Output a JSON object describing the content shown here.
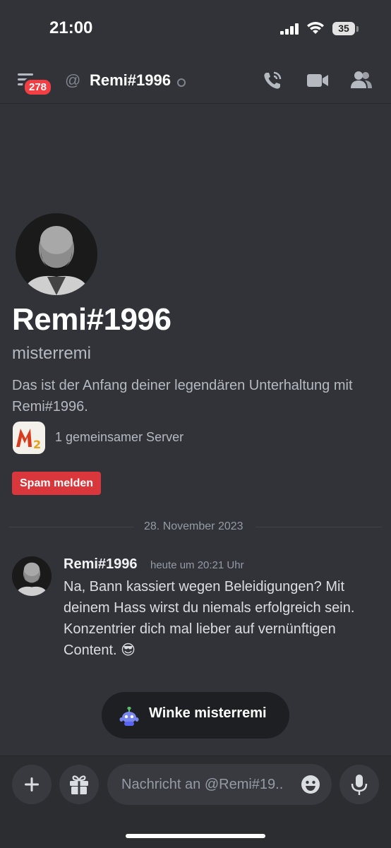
{
  "status_bar": {
    "time": "21:00",
    "battery": "35"
  },
  "header": {
    "notification_count": "278",
    "at_symbol": "@",
    "title": "Remi#1996"
  },
  "profile": {
    "display_name": "Remi#1996",
    "username": "misterremi",
    "intro": "Das ist der Anfang deiner legendären Unterhaltung mit Remi#1996.",
    "mutual_servers": "1 gemeinsamer Server",
    "spam_button": "Spam melden"
  },
  "date_divider": "28. November 2023",
  "message": {
    "author": "Remi#1996",
    "timestamp": "heute um 20:21 Uhr",
    "text": "Na, Bann kassiert wegen Beleidigungen? Mit deinem Hass wirst du niemals erfolgreich sein. Konzentrier dich mal lieber auf vernünftigen Content.",
    "emoji": "😎"
  },
  "wave_button": {
    "label": "Winke misterremi"
  },
  "composer": {
    "placeholder": "Nachricht an @Remi#19.."
  },
  "colors": {
    "background": "#313338",
    "danger": "#da373c",
    "badge": "#f23f43",
    "dark_surface": "#1e1f22"
  },
  "icons": [
    "signal-icon",
    "wifi-icon",
    "battery-icon",
    "channels-menu-icon",
    "at-icon",
    "voice-call-icon",
    "video-call-icon",
    "members-icon",
    "server-icon",
    "wave-sticker-icon",
    "plus-icon",
    "gift-icon",
    "emoji-icon",
    "microphone-icon"
  ]
}
